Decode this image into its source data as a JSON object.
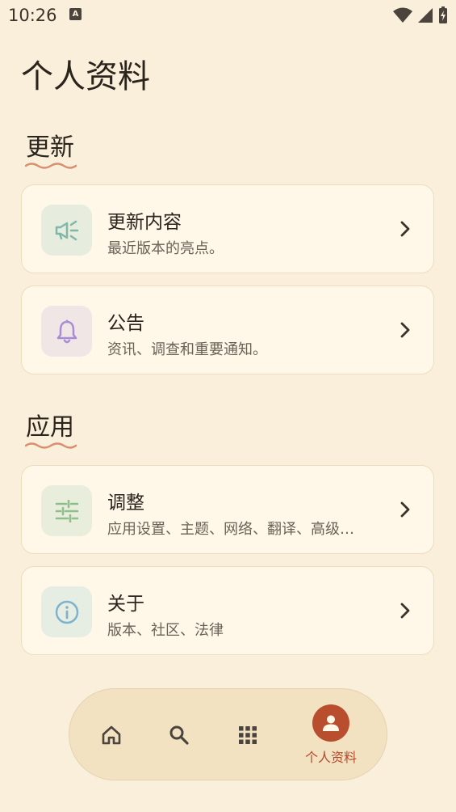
{
  "status_bar": {
    "time": "10:26",
    "notif_icon_letter": "A"
  },
  "page_title": "个人资料",
  "sections": [
    {
      "title": "更新"
    },
    {
      "title": "应用"
    }
  ],
  "cards": [
    {
      "title": "更新内容",
      "subtitle": "最近版本的亮点。",
      "icon": "megaphone-icon",
      "icon_color": "#7FB8A8",
      "icon_bg": "#E7EDDE"
    },
    {
      "title": "公告",
      "subtitle": "资讯、调查和重要通知。",
      "icon": "bell-icon",
      "icon_color": "#A98BD6",
      "icon_bg": "#F0E6E6"
    },
    {
      "title": "调整",
      "subtitle": "应用设置、主题、网络、翻译、高级…",
      "icon": "sliders-icon",
      "icon_color": "#8FBF8C",
      "icon_bg": "#E8EEDB"
    },
    {
      "title": "关于",
      "subtitle": "版本、社区、法律",
      "icon": "info-icon",
      "icon_color": "#7FB3CC",
      "icon_bg": "#E6EDE3"
    }
  ],
  "nav": {
    "items": [
      {
        "name": "home",
        "icon": "home-icon"
      },
      {
        "name": "search",
        "icon": "search-icon"
      },
      {
        "name": "apps",
        "icon": "grid-icon"
      },
      {
        "name": "profile",
        "icon": "person-icon",
        "label": "个人资料",
        "active": true
      }
    ],
    "active_color": "#B84E2E"
  },
  "colors": {
    "background": "#FAEFDA",
    "card": "#FFF7E7",
    "squiggle": "#D88E6F"
  }
}
